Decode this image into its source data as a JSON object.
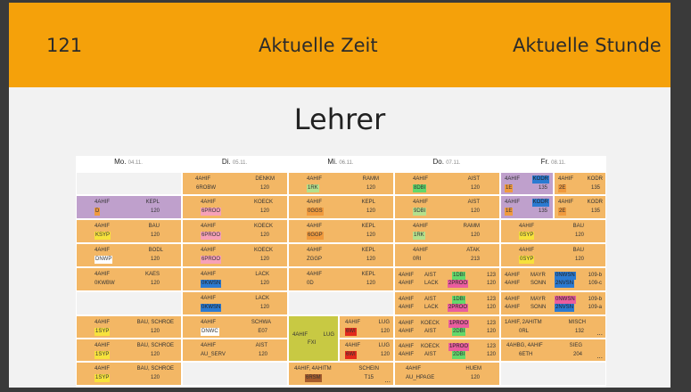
{
  "header": {
    "room": "121",
    "time_label": "Aktuelle Zeit",
    "lesson_label": "Aktuelle Stunde"
  },
  "page_title": "Lehrer",
  "days": [
    {
      "name": "Mo.",
      "date": "04.11."
    },
    {
      "name": "Di.",
      "date": "05.11."
    },
    {
      "name": "Mi.",
      "date": "06.11."
    },
    {
      "name": "Do.",
      "date": "07.11."
    },
    {
      "name": "Fr.",
      "date": "08.11."
    }
  ],
  "grid": {
    "r0": {
      "c1": {
        "a": "4AHIF",
        "b": "DENKM",
        "c": "6ROBW",
        "d": "120"
      },
      "c2": {
        "a": "4AHIF",
        "b": "RAMM",
        "c": "1RK",
        "d": "120"
      },
      "c3": {
        "a": "4AHIF",
        "b": "AIST",
        "c": "8DBI",
        "d": "120"
      },
      "c4a": {
        "a": "4AHIF",
        "b": "KODR",
        "c": "1E",
        "d": "135"
      },
      "c4b": {
        "a": "4AHIF",
        "b": "KODR",
        "c": "2E",
        "d": "135"
      }
    },
    "r1": {
      "c0": {
        "a": "4AHIF",
        "b": "KEPL",
        "c": "D",
        "d": "120"
      },
      "c1": {
        "a": "4AHIF",
        "b": "KOECK",
        "c": "6PROO",
        "d": "120"
      },
      "c2": {
        "a": "4AHIF",
        "b": "KEPL",
        "c": "0GGS",
        "d": "120"
      },
      "c3": {
        "a": "4AHIF",
        "b": "AIST",
        "c": "9DBI",
        "d": "120"
      },
      "c4a": {
        "a": "4AHIF",
        "b": "KODR",
        "c": "1E",
        "d": "135"
      },
      "c4b": {
        "a": "4AHIF",
        "b": "KODR",
        "c": "2E",
        "d": "135"
      }
    },
    "r2": {
      "c0": {
        "a": "4AHIF",
        "b": "BAU",
        "c": "KSYP",
        "d": "120"
      },
      "c1": {
        "a": "4AHIF",
        "b": "KOECK",
        "c": "6PROO",
        "d": "120"
      },
      "c2": {
        "a": "4AHIF",
        "b": "KEPL",
        "c": "6GGP",
        "d": "120"
      },
      "c3": {
        "a": "4AHIF",
        "b": "RAMM",
        "c": "1RK",
        "d": "120"
      },
      "c4": {
        "a": "4AHIF",
        "b": "BAU",
        "c": "0SYP",
        "d": "120"
      }
    },
    "r3": {
      "c0": {
        "a": "4AHIF",
        "b": "BODL",
        "c": "DNWP",
        "d": "120"
      },
      "c1": {
        "a": "4AHIF",
        "b": "KOECK",
        "c": "6PROO",
        "d": "120"
      },
      "c2": {
        "a": "4AHIF",
        "b": "KEPL",
        "c": "ZGGP",
        "d": "120"
      },
      "c3": {
        "a": "4AHIF",
        "b": "ATAK",
        "c": "0RI",
        "d": "213"
      },
      "c4": {
        "a": "4AHIF",
        "b": "BAU",
        "c": "0SYP",
        "d": "120"
      }
    },
    "r4": {
      "c0": {
        "a": "4AHIF",
        "b": "KAES",
        "c": "0KWBW",
        "d": "120"
      },
      "c1": {
        "a": "4AHIF",
        "b": "LACK",
        "c": "0KWSN",
        "d": "120"
      },
      "c2": {
        "a": "4AHIF",
        "b": "KEPL",
        "c": "0D",
        "d": "120"
      },
      "c3": [
        {
          "a": "4AHIF",
          "b": "AIST",
          "c": "1DBI",
          "d": "123"
        },
        {
          "a": "4AHIF",
          "b": "LACK",
          "c": "2PROO",
          "d": "120"
        }
      ],
      "c4": [
        {
          "a": "4AHIF",
          "b": "MAYR",
          "c": "0NWSN",
          "d": "109-b"
        },
        {
          "a": "4AHIF",
          "b": "SONN",
          "c": "2NVSN",
          "d": "109-c"
        }
      ]
    },
    "r5": {
      "c1": {
        "a": "4AHIF",
        "b": "LACK",
        "c": "0KWSN",
        "d": "120"
      },
      "c3": [
        {
          "a": "4AHIF",
          "b": "AIST",
          "c": "1DBI",
          "d": "123"
        },
        {
          "a": "4AHIF",
          "b": "LACK",
          "c": "2PROO",
          "d": "120"
        }
      ],
      "c4": [
        {
          "a": "4AHIF",
          "b": "MAYR",
          "c": "0NWSN",
          "d": "109-b"
        },
        {
          "a": "4AHIF",
          "b": "SONN",
          "c": "2NVSN",
          "d": "109-a"
        }
      ]
    },
    "r6": {
      "c0": {
        "a": "4AHIF",
        "b": "BAU, SCHROE",
        "c": "1SYP",
        "d": "120"
      },
      "c1": {
        "a": "4AHIF",
        "b": "SCHWA",
        "c": "DNWC",
        "d": "E07"
      },
      "c2": {
        "a": "4AHIF",
        "b": "LUG",
        "c": "FXI"
      },
      "c2b": {
        "a": "4AHIF",
        "b": "LUG",
        "c": "6WI",
        "d": "120"
      },
      "c3": [
        {
          "a": "4AHIF",
          "b": "KOECK",
          "c": "1PROO",
          "d": "123"
        },
        {
          "a": "4AHIF",
          "b": "AIST",
          "c": "2DBI",
          "d": "120"
        }
      ],
      "c4": {
        "a": "1AHIF, 2AHITM",
        "b": "MISCH",
        "c": "0RL",
        "d": "132",
        "more": "..."
      }
    },
    "r7": {
      "c0": {
        "a": "4AHIF",
        "b": "BAU, SCHROE",
        "c": "1SYP",
        "d": "120"
      },
      "c1": {
        "a": "4AHIF",
        "b": "AIST",
        "c": "AU_SERV",
        "d": "120"
      },
      "c2b": {
        "a": "4AHIF",
        "b": "LUG",
        "c": "6WI",
        "d": "120"
      },
      "c3": [
        {
          "a": "4AHIF",
          "b": "KOECK",
          "c": "1PROO",
          "d": "123"
        },
        {
          "a": "4AHIF",
          "b": "AIST",
          "c": "2DBI",
          "d": "120"
        }
      ],
      "c4": {
        "a": "4AHBG, 4AHIF",
        "b": "SIEG",
        "c": "6ETH",
        "d": "204",
        "more": "..."
      }
    },
    "r8": {
      "c0": {
        "a": "4AHIF",
        "b": "BAU, SCHROE",
        "c": "1SYP",
        "d": "120"
      },
      "c2": {
        "a": "4AHIF, 4AHITM",
        "b": "SCHEIN",
        "c": "6RSM",
        "d": "T15",
        "more": "..."
      },
      "c3": {
        "a": "4AHIF",
        "b": "HUEM",
        "c": "AU_HPAGE",
        "d": "120"
      }
    }
  },
  "colors": {
    "header": "#f5a10a",
    "cell": "#f3b765",
    "purple": "#bfa0cc",
    "green": "#c8c943"
  }
}
